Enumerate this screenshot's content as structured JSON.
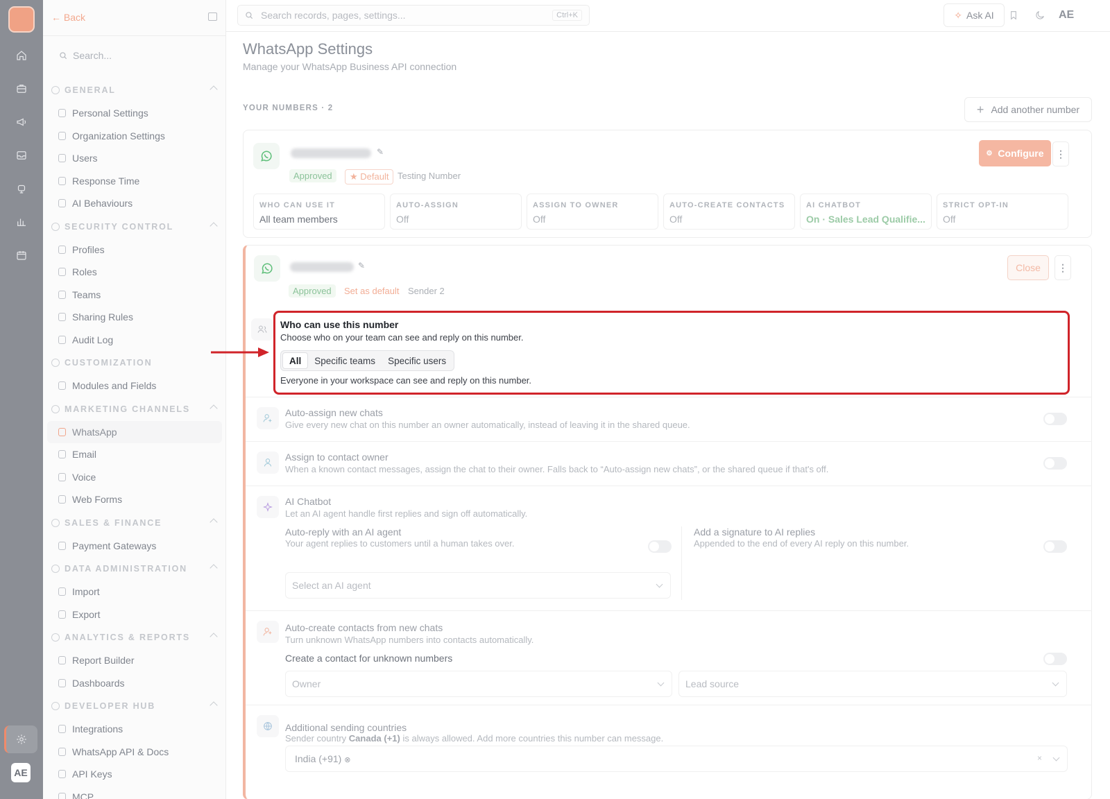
{
  "topbar": {
    "search_placeholder": "Search records, pages, settings...",
    "shortcut": "Ctrl+K",
    "ask_ai": "Ask AI",
    "user_initials": "AE"
  },
  "rail": {
    "avatar": "AE"
  },
  "sidebar": {
    "back": "Back",
    "search_placeholder": "Search...",
    "sections": [
      {
        "label": "GENERAL",
        "items": [
          "Personal Settings",
          "Organization Settings",
          "Users",
          "Response Time",
          "AI Behaviours"
        ]
      },
      {
        "label": "SECURITY CONTROL",
        "items": [
          "Profiles",
          "Roles",
          "Teams",
          "Sharing Rules",
          "Audit Log"
        ]
      },
      {
        "label": "CUSTOMIZATION",
        "items": [
          "Modules and Fields"
        ]
      },
      {
        "label": "MARKETING CHANNELS",
        "items": [
          "WhatsApp",
          "Email",
          "Voice",
          "Web Forms"
        ]
      },
      {
        "label": "SALES & FINANCE",
        "items": [
          "Payment Gateways"
        ]
      },
      {
        "label": "DATA ADMINISTRATION",
        "items": [
          "Import",
          "Export"
        ]
      },
      {
        "label": "ANALYTICS & REPORTS",
        "items": [
          "Report Builder",
          "Dashboards"
        ]
      },
      {
        "label": "DEVELOPER HUB",
        "items": [
          "Integrations",
          "WhatsApp API & Docs",
          "API Keys",
          "MCP"
        ]
      }
    ]
  },
  "page": {
    "title": "WhatsApp Settings",
    "subtitle": "Manage your WhatsApp Business API connection",
    "numbers_label": "YOUR NUMBERS · 2",
    "add_number": "Add another number"
  },
  "number1": {
    "status": "Approved",
    "default_badge": "Default",
    "name": "Testing Number",
    "configure": "Configure",
    "stats": [
      {
        "key": "WHO CAN USE IT",
        "value": "All team members"
      },
      {
        "key": "AUTO-ASSIGN",
        "value": "Off"
      },
      {
        "key": "ASSIGN TO OWNER",
        "value": "Off"
      },
      {
        "key": "AUTO-CREATE CONTACTS",
        "value": "Off"
      },
      {
        "key": "AI CHATBOT",
        "value": "On · Sales Lead Qualifie..."
      },
      {
        "key": "STRICT OPT-IN",
        "value": "Off"
      }
    ]
  },
  "number2": {
    "status": "Approved",
    "set_default": "Set as default",
    "name": "Sender 2",
    "close": "Close",
    "who": {
      "title": "Who can use this number",
      "desc": "Choose who on your team can see and reply on this number.",
      "options": [
        "All",
        "Specific teams",
        "Specific users"
      ],
      "selected": "All",
      "hint": "Everyone in your workspace can see and reply on this number."
    },
    "auto_assign": {
      "title": "Auto-assign new chats",
      "desc": "Give every new chat on this number an owner automatically, instead of leaving it in the shared queue.",
      "enabled": false
    },
    "assign_owner": {
      "title": "Assign to contact owner",
      "desc": "When a known contact messages, assign the chat to their owner. Falls back to “Auto-assign new chats”, or the shared queue if that's off.",
      "enabled": false
    },
    "ai_chatbot": {
      "title": "AI Chatbot",
      "desc": "Let an AI agent handle first replies and sign off automatically.",
      "auto_reply_title": "Auto-reply with an AI agent",
      "auto_reply_desc": "Your agent replies to customers until a human takes over.",
      "agent_placeholder": "Select an AI agent",
      "signature_title": "Add a signature to AI replies",
      "signature_desc": "Appended to the end of every AI reply on this number."
    },
    "auto_create": {
      "title": "Auto-create contacts from new chats",
      "desc": "Turn unknown WhatsApp numbers into contacts automatically.",
      "sub": "Create a contact for unknown numbers",
      "owner_placeholder": "Owner",
      "lead_placeholder": "Lead source"
    },
    "countries": {
      "title": "Additional sending countries",
      "desc_prefix": "Sender country",
      "desc_country": "Canada (+1)",
      "desc_suffix": "is always allowed. Add more countries this number can message.",
      "chip": "India (+91)"
    }
  },
  "colors": {
    "accent": "#f08a6a",
    "highlight": "#d0242a",
    "whatsapp": "#5fbf7a"
  }
}
